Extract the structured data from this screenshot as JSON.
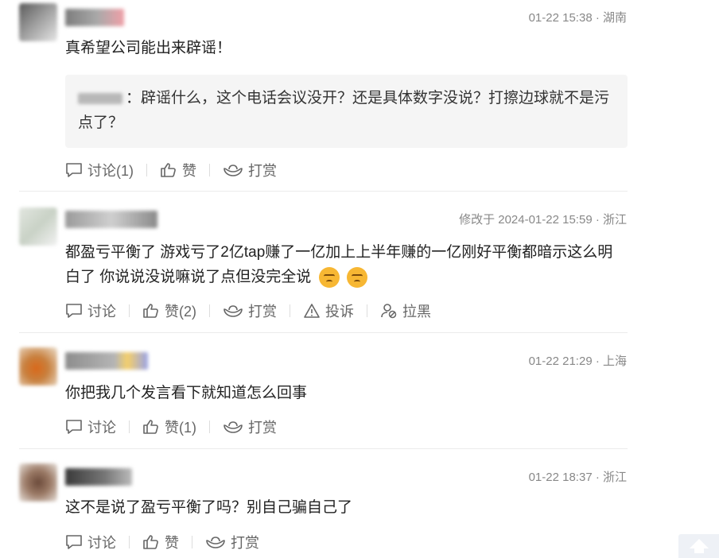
{
  "comments": [
    {
      "meta": "01-22 15:38 · 湖南",
      "text": "真希望公司能出来辟谣！",
      "quote": {
        "text": "：辟谣什么，这个电话会议没开？还是具体数字没说？打擦边球就不是污点了？"
      },
      "actions": {
        "discuss": "讨论(1)",
        "like": "赞",
        "reward": "打赏"
      }
    },
    {
      "meta": "修改于 2024-01-22 15:59 · 浙江",
      "text": "都盈亏平衡了 游戏亏了2亿tap赚了一亿加上上半年赚的一亿刚好平衡都暗示这么明白了 你说说没说嘛说了点但没完全说",
      "actions": {
        "discuss": "讨论",
        "like": "赞(2)",
        "reward": "打赏",
        "report": "投诉",
        "block": "拉黑"
      }
    },
    {
      "meta": "01-22 21:29 · 上海",
      "text": "你把我几个发言看下就知道怎么回事",
      "actions": {
        "discuss": "讨论",
        "like": "赞(1)",
        "reward": "打赏"
      }
    },
    {
      "meta": "01-22 18:37 · 浙江",
      "text": "这不是说了盈亏平衡了吗？别自己骗自己了",
      "actions": {
        "discuss": "讨论",
        "like": "赞",
        "reward": "打赏"
      }
    }
  ],
  "icons": {
    "discuss": "comment-bubble-icon",
    "like": "thumbs-up-icon",
    "reward": "ingot-icon",
    "report": "warning-icon",
    "block": "user-block-icon",
    "emoji": "thinking-face-emoji",
    "scroll_top": "arrow-up-icon"
  }
}
